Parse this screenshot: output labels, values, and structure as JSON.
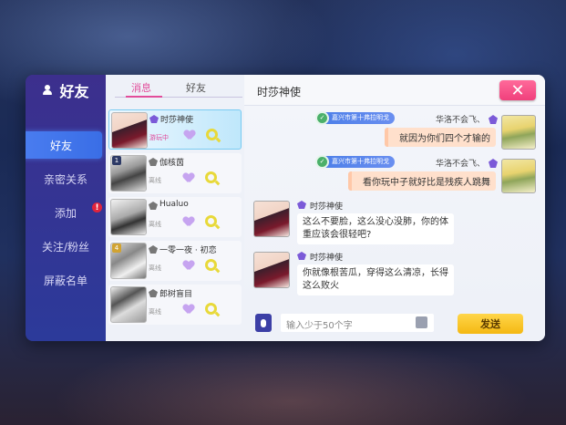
{
  "nav": {
    "title": "好友",
    "items": [
      {
        "label": "好友",
        "active": true
      },
      {
        "label": "亲密关系"
      },
      {
        "label": "添加",
        "badge": "!"
      },
      {
        "label": "关注/粉丝"
      },
      {
        "label": "屏蔽名单"
      }
    ]
  },
  "tabs": {
    "messages": "消息",
    "friends": "好友"
  },
  "friends": [
    {
      "name": "时莎神使",
      "status": "游玩中",
      "online": true,
      "level": ""
    },
    {
      "name": "伽核茵",
      "status": "离线",
      "online": false,
      "level": "1"
    },
    {
      "name": "Hualuo",
      "status": "离线",
      "online": false,
      "level": ""
    },
    {
      "name": "一零一夜 · 初恋",
      "status": "离线",
      "online": false,
      "level": "4"
    },
    {
      "name": "郎树盲目",
      "status": "离线",
      "online": false,
      "level": ""
    }
  ],
  "chat": {
    "title": "时莎神使",
    "close": "✕",
    "messages": [
      {
        "side": "right",
        "guild": "嘉兴市第十弗拉明戈",
        "name": "华洛不会飞、",
        "text": "就因为你们四个才输的"
      },
      {
        "side": "right",
        "guild": "嘉兴市第十弗拉明戈",
        "name": "华洛不会飞、",
        "text": "看你玩中子就好比是残疾人跳舞"
      },
      {
        "side": "left",
        "name": "时莎神使",
        "text": "这么不要脸，这么没心没肺，你的体重应该会很轻吧?"
      },
      {
        "side": "left",
        "name": "时莎神使",
        "text": "你就像根苦瓜，穿得这么清凉，长得这么败火"
      }
    ],
    "input_placeholder": "输入少于50个字",
    "send": "发送"
  }
}
